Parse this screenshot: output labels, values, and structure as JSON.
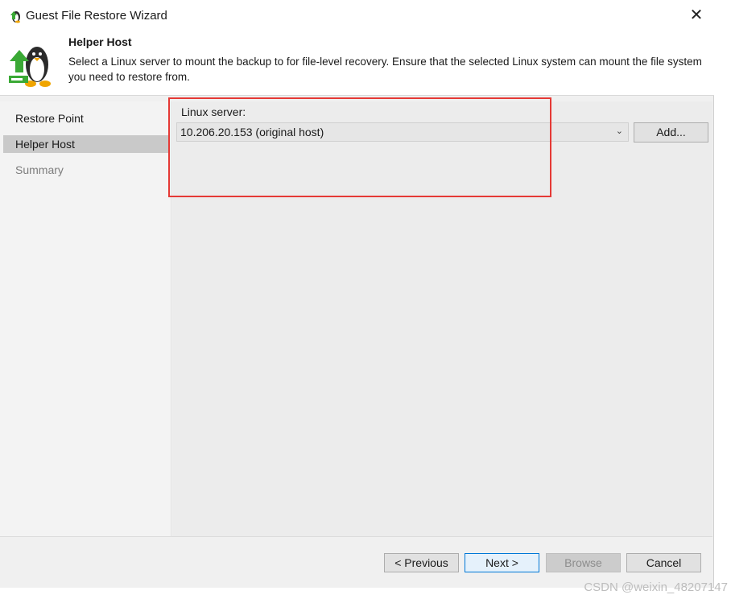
{
  "window": {
    "title": "Guest File Restore Wizard",
    "close_glyph": "✕"
  },
  "header": {
    "title": "Helper Host",
    "description": "Select a Linux server to mount the backup to for file-level recovery. Ensure that the selected Linux system can mount the file system you need to restore from.",
    "icon": "linux-penguin-upload-icon"
  },
  "sidebar": {
    "items": [
      {
        "label": "Restore Point",
        "state": "normal"
      },
      {
        "label": "Helper Host",
        "state": "active"
      },
      {
        "label": "Summary",
        "state": "disabled"
      }
    ]
  },
  "form": {
    "linux_server_label": "Linux server:",
    "linux_server_value": "10.206.20.153 (original host)",
    "add_label": "Add..."
  },
  "footer": {
    "previous_label": "< Previous",
    "next_label": "Next >",
    "browse_label": "Browse",
    "cancel_label": "Cancel"
  },
  "watermark": "CSDN @weixin_48207147",
  "colors": {
    "highlight": "#e53935",
    "active_nav": "#c9c9c9",
    "accent": "#0078d7"
  }
}
